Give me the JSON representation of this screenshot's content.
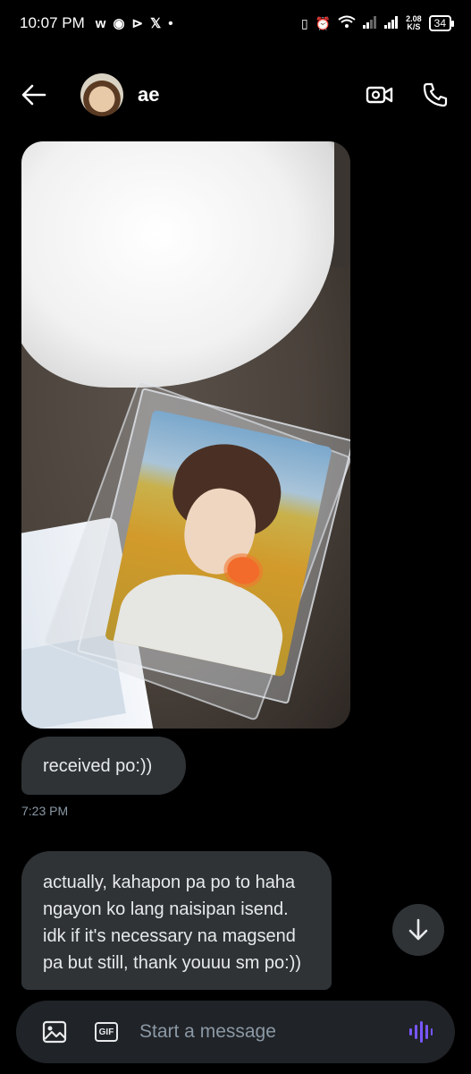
{
  "status_bar": {
    "time": "10:07 PM",
    "net_speed": "2.08",
    "net_unit": "K/S",
    "battery": "34"
  },
  "header": {
    "contact_name": "ae"
  },
  "messages": [
    {
      "text": "received po:))"
    },
    {
      "text": "actually, kahapon pa po to haha ngayon ko lang naisipan isend. idk if it's necessary na magsend pa but still, thank youuu sm po:))"
    }
  ],
  "timestamp": "7:23 PM",
  "composer": {
    "placeholder": "Start a message",
    "gif_label": "GIF"
  },
  "colors": {
    "background": "#000000",
    "bubble": "#2f3336",
    "composer": "#202327",
    "voice_accent": "#7856ff"
  }
}
